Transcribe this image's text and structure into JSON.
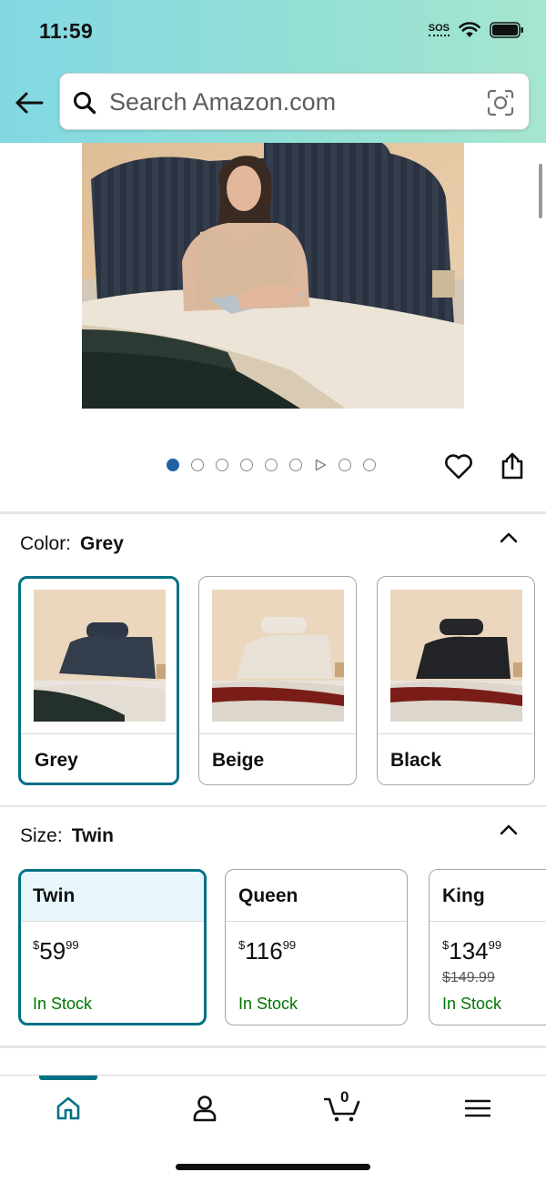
{
  "status_bar": {
    "time": "11:59",
    "sos": "SOS"
  },
  "search": {
    "placeholder": "Search Amazon.com"
  },
  "icons": {
    "back": "arrow-left-icon",
    "search": "search-icon",
    "camera": "camera-lens-icon",
    "favorite": "heart-icon",
    "share": "share-icon",
    "home": "home-icon",
    "account": "person-icon",
    "cart": "cart-icon",
    "menu": "menu-icon"
  },
  "carousel": {
    "total_dots": 9,
    "active_index": 0,
    "video_index": 6
  },
  "colors": {
    "accent": "#007185",
    "in_stock": "#007600",
    "active_dot": "#2162a1"
  },
  "color_selector": {
    "label": "Color:",
    "selected": "Grey",
    "options": [
      {
        "name": "Grey",
        "selected": true
      },
      {
        "name": "Beige",
        "selected": false
      },
      {
        "name": "Black",
        "selected": false
      }
    ]
  },
  "size_selector": {
    "label": "Size:",
    "selected": "Twin",
    "options": [
      {
        "name": "Twin",
        "price_symbol": "$",
        "price_whole": "59",
        "price_fraction": "99",
        "list_price": "",
        "availability": "In Stock",
        "selected": true
      },
      {
        "name": "Queen",
        "price_symbol": "$",
        "price_whole": "116",
        "price_fraction": "99",
        "list_price": "",
        "availability": "In Stock",
        "selected": false
      },
      {
        "name": "King",
        "price_symbol": "$",
        "price_whole": "134",
        "price_fraction": "99",
        "list_price": "$149.99",
        "availability": "In Stock",
        "selected": false
      }
    ]
  },
  "bottom_nav": {
    "cart_count": "0",
    "active_tab": "home"
  }
}
